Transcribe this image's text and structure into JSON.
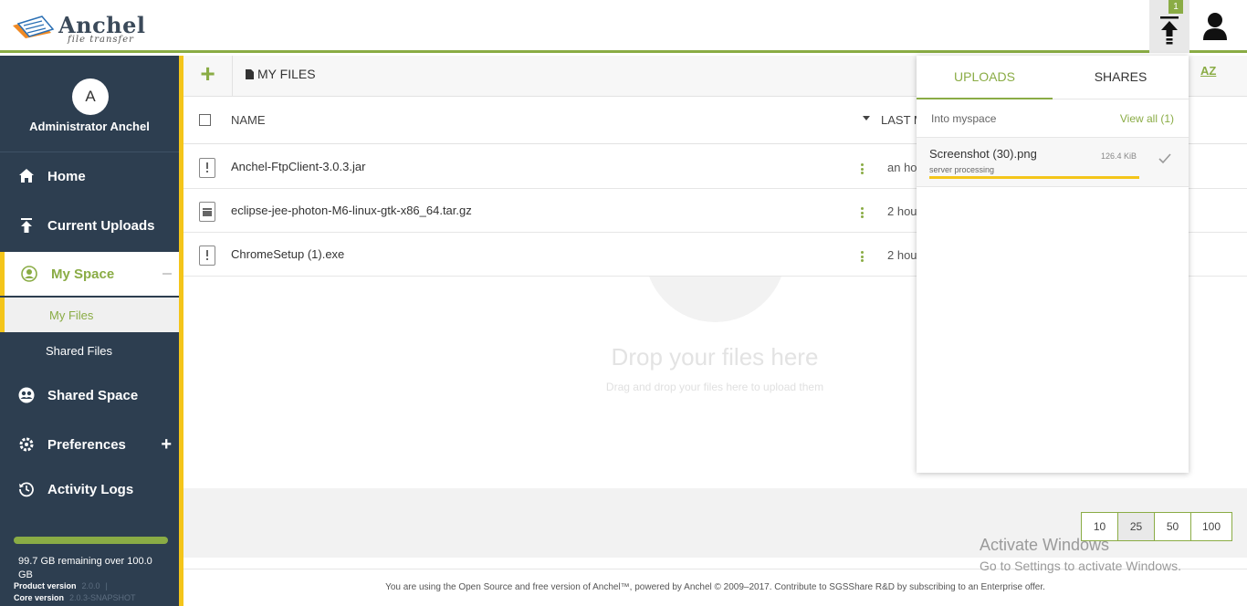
{
  "app": {
    "logo_word": "Anchel",
    "logo_tagline": "file transfer",
    "upload_badge": "1"
  },
  "sidebar": {
    "avatar_initial": "A",
    "user_name": "Administrator Anchel",
    "items": [
      {
        "label": "Home",
        "icon": "home-icon"
      },
      {
        "label": "Current Uploads",
        "icon": "upload-icon"
      },
      {
        "label": "My Space",
        "icon": "user-circle-icon"
      },
      {
        "label": "Shared Space",
        "icon": "group-icon"
      },
      {
        "label": "Preferences",
        "icon": "gear-icon"
      },
      {
        "label": "Activity Logs",
        "icon": "history-icon"
      }
    ],
    "sub_items": [
      {
        "label": "My Files"
      },
      {
        "label": "Shared Files"
      }
    ],
    "quota_fraction": 0.997,
    "quota_text": "99.7 GB remaining over 100.0 GB",
    "product_version_label": "Product version",
    "product_version_value": "2.0.0",
    "core_version_label": "Core version",
    "core_version_value": "2.0.3-SNAPSHOT"
  },
  "toolbar": {
    "add_label": "+",
    "breadcrumb": "MY FILES",
    "sort_label": "AZ"
  },
  "table": {
    "col_name": "NAME",
    "col_last": "LAST M",
    "rows": [
      {
        "name": "Anchel-FtpClient-3.0.3.jar",
        "time": "an ho",
        "icon": "file-alert-icon"
      },
      {
        "name": "eclipse-jee-photon-M6-linux-gtk-x86_64.tar.gz",
        "time": "2 hou",
        "icon": "archive-icon"
      },
      {
        "name": "ChromeSetup (1).exe",
        "time": "2 hou",
        "icon": "file-alert-icon"
      }
    ]
  },
  "dropzone": {
    "title": "Drop your files here",
    "subtitle": "Drag and drop your files here to upload them"
  },
  "pager": {
    "options": [
      "10",
      "25",
      "50",
      "100"
    ],
    "selected": "25"
  },
  "footer": {
    "text": "You are using the Open Source and free version of Anchel™, powered by Anchel © 2009–2017. Contribute to SGSShare R&D by subscribing to an Enterprise offer."
  },
  "watermark": {
    "line1": "Activate Windows",
    "line2": "Go to Settings to activate Windows."
  },
  "upload_panel": {
    "tab_uploads": "UPLOADS",
    "tab_shares": "SHARES",
    "subtitle": "Into myspace",
    "view_all": "View all (1)",
    "item_name": "Screenshot (30).png",
    "item_size": "126.4 KiB",
    "item_status": "server processing",
    "progress": 1.0
  },
  "colors": {
    "accent_green": "#8aac45",
    "accent_yellow": "#f4c51a",
    "sidebar_bg": "#2d3e50"
  }
}
